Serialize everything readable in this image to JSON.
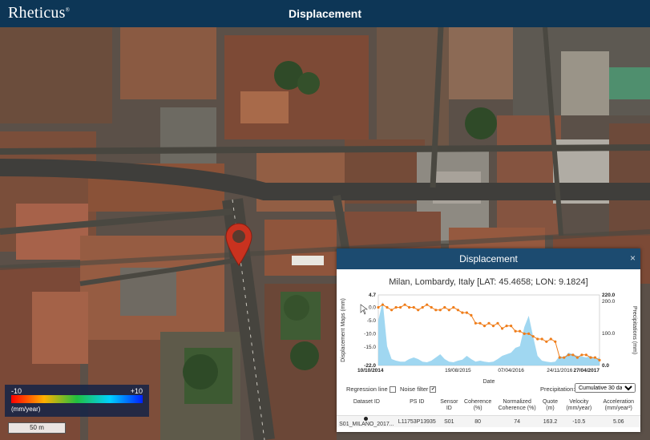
{
  "header": {
    "logo": "Rheticus",
    "logo_mark": "®",
    "title": "Displacement"
  },
  "legend": {
    "min": "-10",
    "max": "+10",
    "unit": "(mm/year)"
  },
  "scale": {
    "label": "50 m"
  },
  "popup": {
    "title": "Displacement",
    "close": "×",
    "location": "Milan, Lombardy, Italy [LAT: 45.4658; LON: 9.1824]",
    "controls": {
      "regression_label": "Regression line",
      "regression_checked": "",
      "noise_label": "Noise filter",
      "noise_checked": "✔",
      "precip_label": "Precipitation:",
      "precip_value": "Cumulative 30 days",
      "precip_arrow": "▼"
    },
    "table": {
      "headers": [
        "Dataset ID",
        "PS ID",
        "Sensor ID",
        "Coherence (%)",
        "Normalized Coherence (%)",
        "Quote (m)",
        "Velocity (mm/year)",
        "Acceleration (mm/year²)"
      ],
      "row": [
        "S01_MILANO_2017...",
        "L11753P13935",
        "S01",
        "80",
        "74",
        "163.2",
        "-10.5",
        "5.06"
      ]
    }
  },
  "chart_data": {
    "type": "line",
    "y_left_label": "Displacement Maps (mm)",
    "y_right_label": "Precipitations (mm)",
    "x_label": "Date",
    "y_left_ticks": [
      "4.7",
      "0.0",
      "-5.0",
      "-10.0",
      "-15.0",
      "-22.0"
    ],
    "y_right_ticks": [
      "220.0",
      "200.0",
      "100.0",
      "0.0"
    ],
    "x_ticks": [
      "10/10/2014",
      "19/08/2015",
      "07/04/2016",
      "24/11/2016",
      "27/04/2017"
    ],
    "ylim_left": [
      -22,
      4.7
    ],
    "ylim_right": [
      0,
      220
    ],
    "series": [
      {
        "name": "",
        "x": [
          0.0,
          0.02,
          0.04,
          0.06,
          0.08,
          0.1,
          0.12,
          0.14,
          0.16,
          0.18,
          0.2,
          0.22,
          0.24,
          0.26,
          0.28,
          0.3,
          0.32,
          0.34,
          0.36,
          0.38,
          0.4,
          0.42,
          0.44,
          0.46,
          0.48,
          0.5,
          0.52,
          0.54,
          0.56,
          0.58,
          0.6,
          0.62,
          0.64,
          0.66,
          0.68,
          0.7,
          0.72,
          0.74,
          0.76,
          0.78,
          0.8,
          0.82,
          0.84,
          0.86,
          0.88,
          0.9,
          0.92,
          0.94,
          0.96,
          0.98,
          1.0
        ],
        "values": [
          0,
          1,
          0,
          -1,
          0,
          0,
          1,
          0,
          0,
          -1,
          0,
          1,
          0,
          -1,
          -1,
          0,
          -1,
          0,
          -1,
          -2,
          -2,
          -3,
          -6,
          -6,
          -7,
          -6,
          -7,
          -6,
          -8,
          -7,
          -7,
          -9,
          -9,
          -10,
          -10,
          -11,
          -12,
          -12,
          -13,
          -12,
          -13,
          -19,
          -19,
          -18,
          -18,
          -19,
          -18,
          -18,
          -19,
          -19,
          -20
        ]
      }
    ],
    "precipitation": [
      140,
      200,
      60,
      20,
      15,
      12,
      12,
      20,
      25,
      20,
      12,
      10,
      15,
      25,
      35,
      20,
      12,
      10,
      15,
      18,
      30,
      20,
      12,
      15,
      12,
      10,
      12,
      20,
      30,
      35,
      40,
      55,
      60,
      120,
      155,
      90,
      30,
      15,
      12,
      10,
      12,
      30,
      25,
      40,
      35,
      30,
      28,
      25,
      30,
      20,
      25
    ]
  }
}
